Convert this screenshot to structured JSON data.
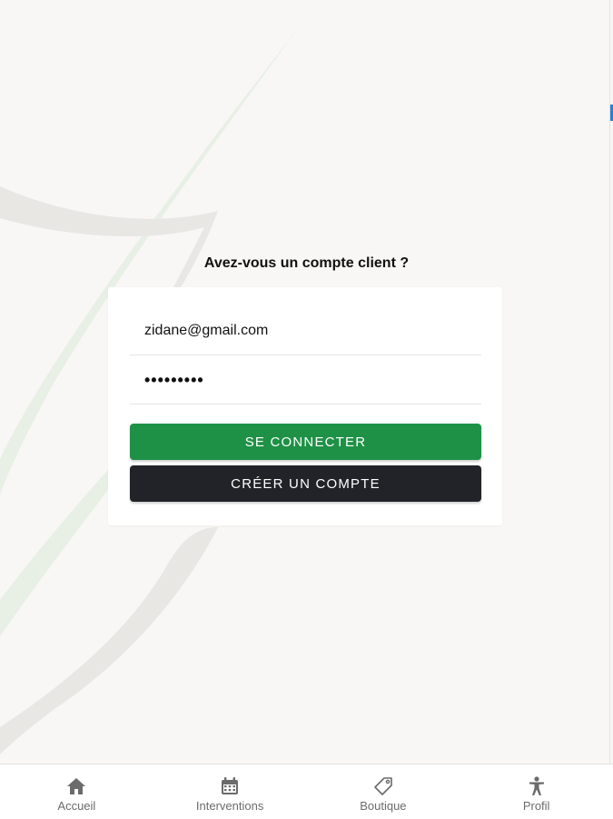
{
  "login": {
    "title": "Avez-vous un compte client ?",
    "email_value": "zidane@gmail.com",
    "password_value": "•••••••••",
    "connect_label": "SE CONNECTER",
    "create_label": "CRÉER UN COMPTE"
  },
  "tabbar": {
    "items": [
      {
        "label": "Accueil",
        "icon": "home-icon"
      },
      {
        "label": "Interventions",
        "icon": "calendar-icon"
      },
      {
        "label": "Boutique",
        "icon": "tag-icon"
      },
      {
        "label": "Profil",
        "icon": "person-icon"
      }
    ]
  },
  "colors": {
    "primary": "#1e9146",
    "dark": "#212328",
    "background": "#f8f7f5"
  }
}
